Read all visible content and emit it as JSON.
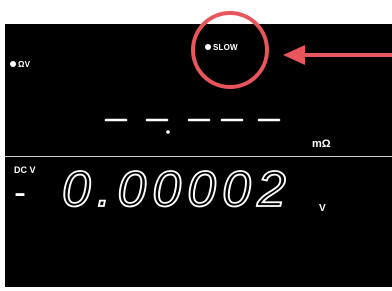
{
  "display": {
    "mode_indicator": "ΩV",
    "slow_indicator": "SLOW",
    "upper": {
      "reading": "- - . - - - -",
      "unit": "mΩ"
    },
    "lower": {
      "function": "DC V",
      "sign": "-",
      "reading": "0.00002",
      "unit": "V"
    }
  },
  "annotation": {
    "circle_color": "#e8555a",
    "arrow_color": "#e8555a"
  }
}
